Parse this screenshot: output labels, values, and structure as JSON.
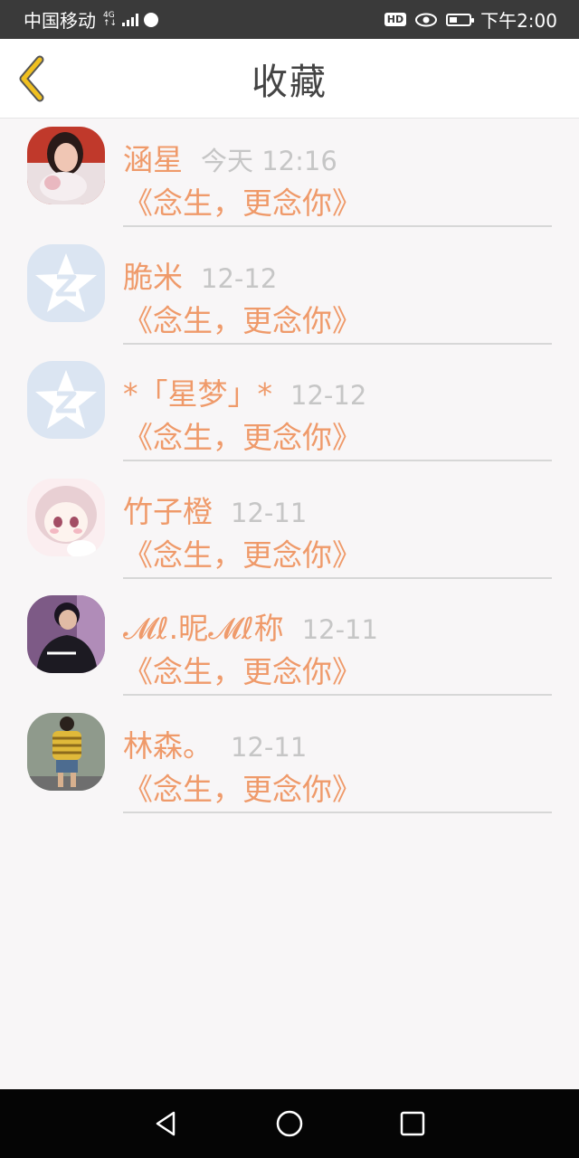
{
  "status_bar": {
    "carrier": "中国移动",
    "network_top": "4G",
    "network_bottom": "↑↓",
    "hd": "HD",
    "time": "下午2:00"
  },
  "header": {
    "title": "收藏",
    "back_icon": "chevron-left-icon"
  },
  "items": [
    {
      "name": "涵星",
      "time": "今天 12:16",
      "message": "《念生，更念你》",
      "avatar": "photo-avatar"
    },
    {
      "name": "脆米",
      "time": "12-12",
      "message": "《念生，更念你》",
      "avatar": "qq-default-avatar"
    },
    {
      "name": "*「星梦」*",
      "time": "12-12",
      "message": "《念生，更念你》",
      "avatar": "qq-default-avatar"
    },
    {
      "name": "竹子橙",
      "time": "12-11",
      "message": "《念生，更念你》",
      "avatar": "anime-avatar"
    },
    {
      "name": "𝓜ℓ.昵𝓜ℓ称",
      "time": "12-11",
      "message": "《念生，更念你》",
      "avatar": "photo-avatar"
    },
    {
      "name": "林森。",
      "time": "12-11",
      "message": "《念生，更念你》",
      "avatar": "photo-avatar"
    }
  ],
  "colors": {
    "accent": "#ef9a6a",
    "back_arrow": "#f0c020",
    "time_text": "#c6c6c6",
    "status_bar": "#3a3a3a",
    "nav_bar": "#050505",
    "background": "#f8f6f7"
  },
  "nav": {
    "back": "triangle-back-icon",
    "home": "circle-home-icon",
    "recent": "square-recent-icon"
  }
}
